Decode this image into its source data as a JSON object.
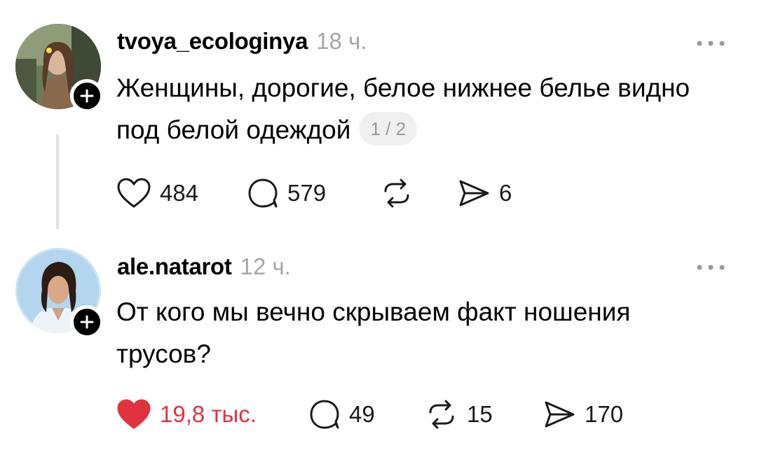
{
  "posts": [
    {
      "username": "tvoya_ecologinya",
      "time": "18 ч.",
      "text": "Женщины, дорогие, белое нижнее белье видно под белой одеждой",
      "page_badge": "1 / 2",
      "liked": false,
      "likes": "484",
      "replies": "579",
      "reposts": "",
      "shares": "6"
    },
    {
      "username": "ale.natarot",
      "time": "12 ч.",
      "text": "От кого мы вечно скрываем факт ношения трусов?",
      "liked": true,
      "likes": "19,8 тыс.",
      "replies": "49",
      "reposts": "15",
      "shares": "170"
    }
  ],
  "icons": {
    "follow": "plus-icon",
    "more": "more-horizontal-icon",
    "like": "heart-icon",
    "reply": "speech-bubble-icon",
    "repost": "repost-arrows-icon",
    "share": "paper-plane-icon"
  },
  "colors": {
    "liked_heart": "#e0333d",
    "secondary_text": "#a6a6a6",
    "thread_line": "#e3e3e3"
  }
}
